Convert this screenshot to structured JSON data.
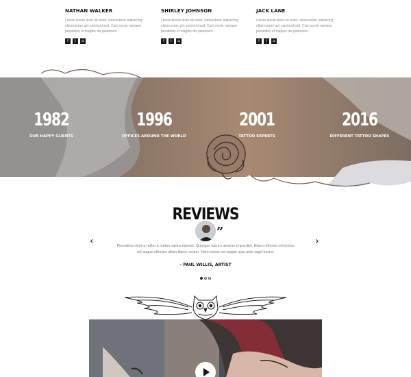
{
  "team": [
    {
      "name": "NATHAN WALKER",
      "bio": "Lorem ipsum dolor sit amet, consectetur adipiscing ullamcorper get euismod sed. Cum sociis natoque penatibus et magnis dis parturient."
    },
    {
      "name": "SHIRLEY JOHNSON",
      "bio": "Lorem ipsum dolor sit amet, consectetur adipiscing ullamcorper get euismod sed. Cum sociis natoque penatibus et magnis dis parturient."
    },
    {
      "name": "JACK LANE",
      "bio": "Lorem ipsum dolor sit amet, consectetur adipiscing ullamcorper get euismod sed. Cum sociis natoque penatibus et magnis dis parturient."
    }
  ],
  "social_icons": [
    "facebook-icon",
    "twitter-icon",
    "instagram-icon"
  ],
  "stats": [
    {
      "number": "1982",
      "label": "OUR HAPPY CLIENTS"
    },
    {
      "number": "1996",
      "label": "OFFICES AROUND THE WORLD"
    },
    {
      "number": "2001",
      "label": "TATTOO EXPERTS"
    },
    {
      "number": "2016",
      "label": "DIFFERENT TATTOO SHAPES"
    }
  ],
  "reviews": {
    "title": "REVIEWS",
    "quote": "Phasellus viverra nulla ut metus varius laoreet. Quisque rutrum aenean imperdiet. Etiam ultricies vel luctus vel augue ultricies ullam libero corper. Nam luctus vel augue quis ante sagit luctus.",
    "author": "– PAUL WILLIS, ARTIST",
    "prev": "‹",
    "next": "›",
    "slide_count": 3,
    "active_slide": 1
  },
  "colors": {
    "dark": "#111111",
    "muted_text": "#8b8b8b",
    "stats_overlay": "#7a6a5e"
  }
}
